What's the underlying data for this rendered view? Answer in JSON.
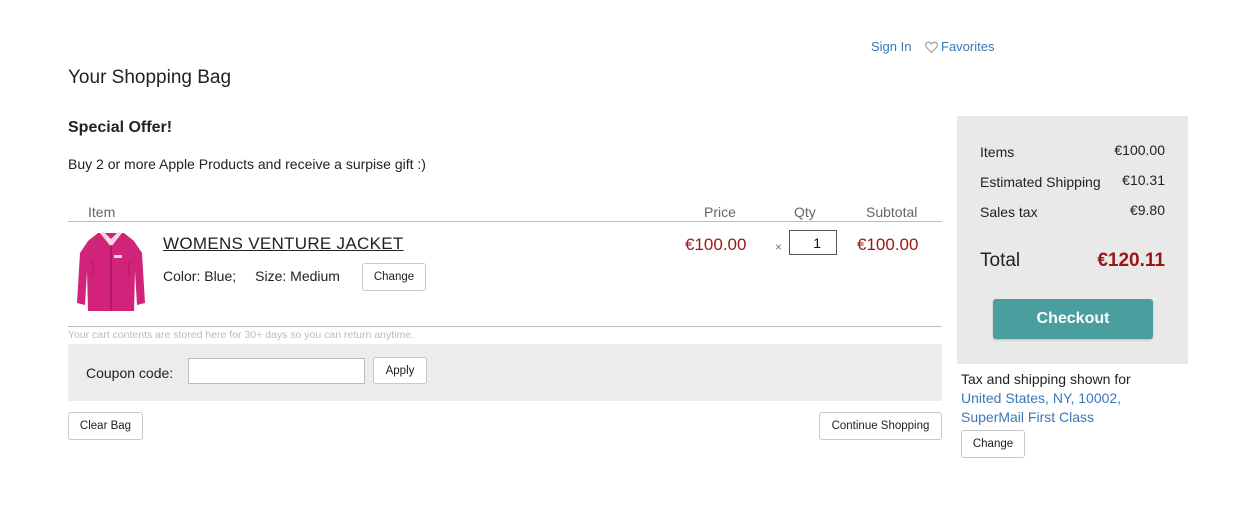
{
  "header": {
    "sign_in": "Sign In",
    "favorites": "Favorites"
  },
  "page": {
    "title": "Your Shopping Bag"
  },
  "offer": {
    "title": "Special Offer!",
    "text": "Buy 2 or more Apple Products and receive a surpise gift :)"
  },
  "cart": {
    "columns": {
      "item": "Item",
      "price": "Price",
      "qty": "Qty",
      "subtotal": "Subtotal"
    },
    "items": [
      {
        "name": "WOMENS VENTURE JACKET",
        "color": "Color: Blue;",
        "size": "Size: Medium",
        "change_label": "Change",
        "price": "€100.00",
        "times": "×",
        "qty": "1",
        "subtotal": "€100.00",
        "image": "pink-jacket-image"
      }
    ],
    "note": "Your cart contents are stored here for 30+ days so you can return anytime."
  },
  "coupon": {
    "label": "Coupon code:",
    "value": "",
    "apply_label": "Apply"
  },
  "actions": {
    "clear_bag": "Clear Bag",
    "continue_shopping": "Continue Shopping"
  },
  "summary": {
    "items_label": "Items",
    "items_value": "€100.00",
    "shipping_label": "Estimated Shipping",
    "shipping_value": "€10.31",
    "tax_label": "Sales tax",
    "tax_value": "€9.80",
    "total_label": "Total",
    "total_value": "€120.11",
    "checkout_label": "Checkout"
  },
  "shipping_info": {
    "label": "Tax and shipping shown for",
    "location": "United States, NY, 10002,",
    "method": "SuperMail First Class",
    "change_label": "Change"
  },
  "colors": {
    "link": "#3a78b5",
    "price": "#9b1616",
    "checkout": "#4a9e9e",
    "panel": "#e9e9e9",
    "jacket": "#d2237a"
  }
}
